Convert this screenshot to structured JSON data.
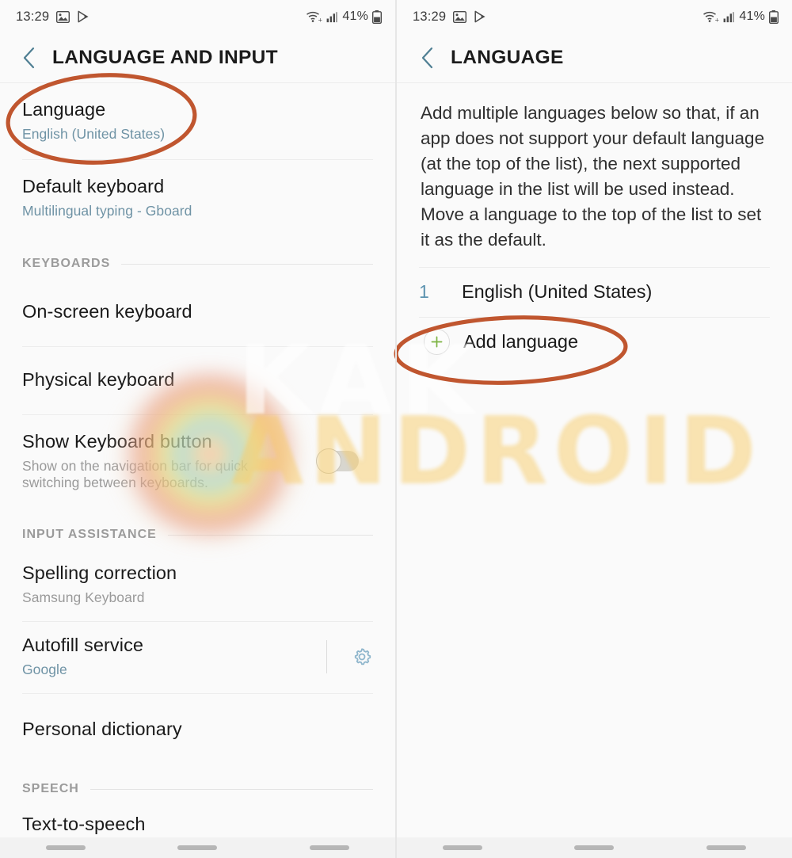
{
  "colors": {
    "accent_subtitle": "#6f93a5",
    "annotation_ellipse": "#c0562f",
    "plus_green": "#7cb342",
    "list_number": "#5d93b0",
    "gear_blue": "#8fb6cc",
    "watermark_yellow": "#f7cc68",
    "background": "#fafafa"
  },
  "left_screen": {
    "status_bar": {
      "time": "13:29",
      "icons": [
        "image-icon",
        "play-store-icon",
        "wifi-icon",
        "signal-icon"
      ],
      "battery_percent": "41%"
    },
    "app_bar": {
      "back_icon": "back-chevron-icon",
      "title": "LANGUAGE AND INPUT"
    },
    "rows": [
      {
        "title": "Language",
        "subtitle": "English (United States)",
        "subtitle_style": "accent",
        "annotated": true
      },
      {
        "title": "Default keyboard",
        "subtitle": "Multilingual typing - Gboard",
        "subtitle_style": "accent"
      }
    ],
    "sections": [
      {
        "header": "KEYBOARDS",
        "rows": [
          {
            "title": "On-screen keyboard",
            "subtitle": ""
          },
          {
            "title": "Physical keyboard",
            "subtitle": ""
          },
          {
            "title": "Show Keyboard button",
            "subtitle": "Show on the navigation bar for quick switching between keyboards.",
            "subtitle_style": "grey",
            "control": "toggle",
            "toggle_on": false
          }
        ]
      },
      {
        "header": "INPUT ASSISTANCE",
        "rows": [
          {
            "title": "Spelling correction",
            "subtitle": "Samsung Keyboard",
            "subtitle_style": "grey"
          },
          {
            "title": "Autofill service",
            "subtitle": "Google",
            "subtitle_style": "accent",
            "control": "gear"
          },
          {
            "title": "Personal dictionary",
            "subtitle": ""
          }
        ]
      },
      {
        "header": "SPEECH",
        "rows": [
          {
            "title": "Text-to-speech",
            "subtitle": ""
          }
        ]
      }
    ]
  },
  "right_screen": {
    "status_bar": {
      "time": "13:29",
      "icons": [
        "image-icon",
        "play-store-icon",
        "wifi-icon",
        "signal-icon"
      ],
      "battery_percent": "41%"
    },
    "app_bar": {
      "back_icon": "back-chevron-icon",
      "title": "LANGUAGE"
    },
    "description": "Add multiple languages below so that, if an app does not support your default language (at the top of the list), the next supported language in the list will be used instead. Move a language to the top of the list to set it as the default.",
    "language_list": [
      {
        "index": "1",
        "label": "English (United States)"
      }
    ],
    "add_language": {
      "label": "Add language",
      "icon": "plus-circle-icon",
      "annotated": true
    }
  },
  "watermark": {
    "primary_text": "ANDROID",
    "secondary_text": "KAK"
  },
  "nav_bar": {
    "items": [
      "recents-pill",
      "home-pill",
      "back-pill"
    ]
  }
}
